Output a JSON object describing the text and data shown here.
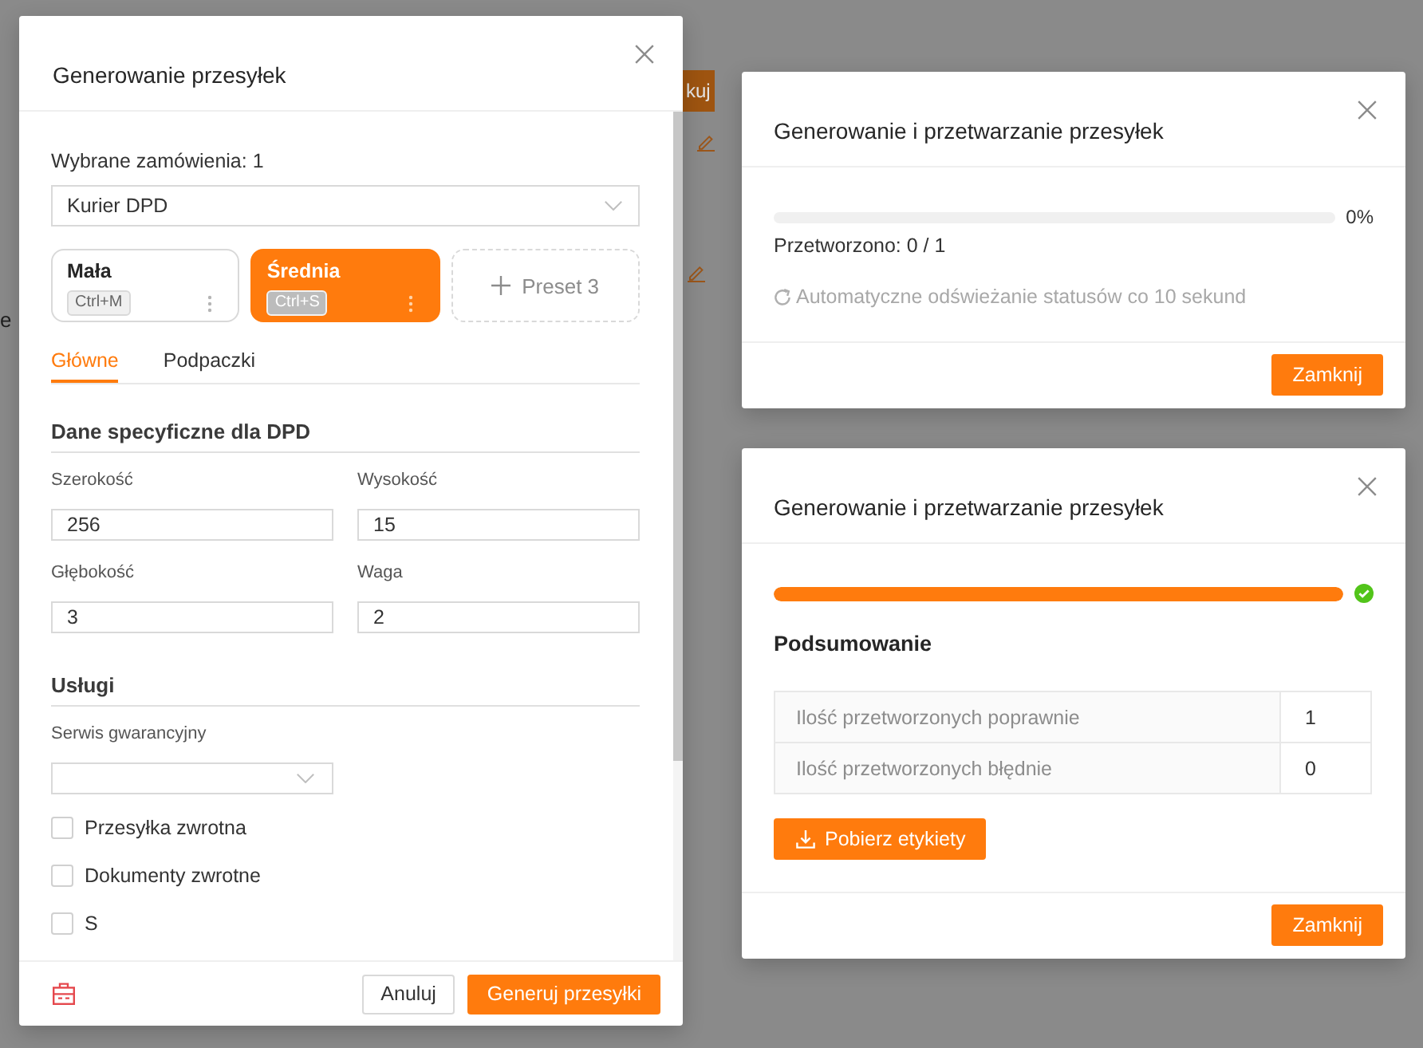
{
  "background_page": {
    "text_fragment": "e",
    "button_fragment": "kuj"
  },
  "generate_dialog": {
    "title": "Generowanie przesyłek",
    "orders_label": "Wybrane zamówienia: 1",
    "carrier_select": {
      "value": "Kurier DPD"
    },
    "presets": [
      {
        "kind": "preset",
        "name": "Mała",
        "shortcut": "Ctrl+M",
        "selected": false
      },
      {
        "kind": "preset",
        "name": "Średnia",
        "shortcut": "Ctrl+S",
        "selected": true
      },
      {
        "kind": "add",
        "label": "Preset 3"
      }
    ],
    "tabs": [
      {
        "label": "Główne",
        "selected": true
      },
      {
        "label": "Podpaczki",
        "selected": false
      }
    ],
    "sections": [
      {
        "title": "Dane specyficzne dla DPD",
        "fields": [
          {
            "kind": "input",
            "label": "Szerokość",
            "value": "256"
          },
          {
            "kind": "input",
            "label": "Wysokość",
            "value": "15"
          },
          {
            "kind": "input",
            "label": "Głębokość",
            "value": "3"
          },
          {
            "kind": "input",
            "label": "Waga",
            "value": "2"
          }
        ]
      },
      {
        "title": "Usługi",
        "fields": [
          {
            "kind": "select",
            "label": "Serwis gwarancyjny"
          }
        ],
        "checkboxes": [
          {
            "label": "Przesyłka zwrotna",
            "checked": false
          },
          {
            "label": "Dokumenty zwrotne",
            "checked": false
          },
          {
            "label": "S",
            "checked": false
          }
        ]
      }
    ],
    "buttons": [
      {
        "kind": "secondary",
        "label": "Anuluj"
      },
      {
        "kind": "primary",
        "label": "Generuj przesyłki"
      }
    ]
  },
  "processing_dialogs": [
    {
      "title": "Generowanie i przetwarzanie przesyłek",
      "progress": {
        "level": 0,
        "complete": false,
        "reading": "0%"
      },
      "processed_label": "Przetworzono: 0 / 1",
      "refresh_note": "Automatyczne odświeżanie statusów co 10 sekund",
      "buttons": [
        {
          "kind": "primary",
          "label": "Zamknij"
        }
      ]
    },
    {
      "title": "Generowanie i przetwarzanie przesyłek",
      "progress": {
        "level": 1,
        "complete": true
      },
      "summary": {
        "title": "Podsumowanie",
        "rows": [
          {
            "label": "Ilość przetworzonych poprawnie",
            "value": "1"
          },
          {
            "label": "Ilość przetworzonych błędnie",
            "value": "0"
          }
        ]
      },
      "download_button": {
        "label": "Pobierz etykiety"
      },
      "buttons": [
        {
          "kind": "primary",
          "label": "Zamknij"
        }
      ]
    }
  ]
}
